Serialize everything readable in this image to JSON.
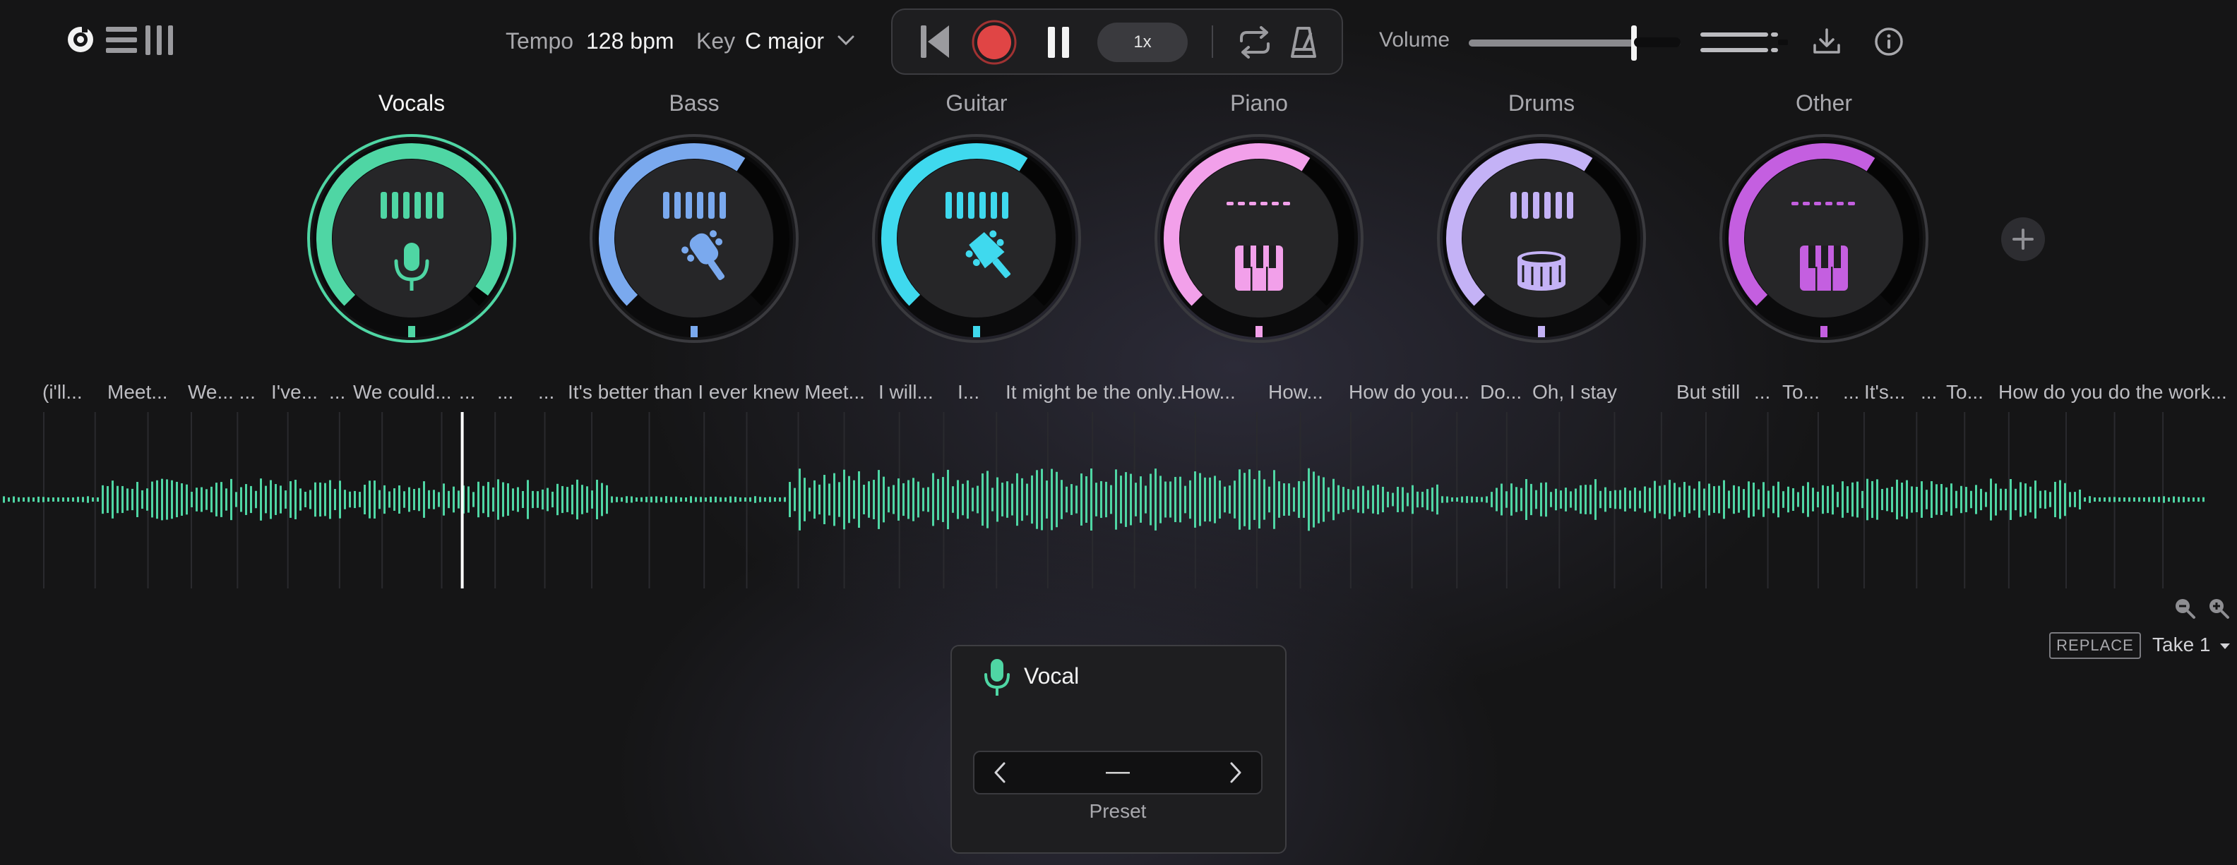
{
  "toolbar": {
    "logo_icon": "record-logo-icon",
    "list_icon": "list-view-icon",
    "columns_icon": "columns-view-icon"
  },
  "project": {
    "tempo_label": "Tempo",
    "tempo_value": "128 bpm",
    "key_label": "Key",
    "key_value": "C major"
  },
  "transport": {
    "speed": "1x",
    "colors": {
      "record": "#e04545"
    }
  },
  "volume": {
    "label": "Volume",
    "level": 0.78
  },
  "stems": [
    {
      "name": "Vocals",
      "color": "#4fd6a4",
      "icon": "microphone-icon",
      "level": 0.97,
      "meter": "bars",
      "active": true
    },
    {
      "name": "Bass",
      "color": "#7aa9ee",
      "icon": "bass-guitar-icon",
      "level": 0.62,
      "meter": "bars",
      "active": false
    },
    {
      "name": "Guitar",
      "color": "#3fd9ee",
      "icon": "guitar-headstock-icon",
      "level": 0.62,
      "meter": "bars",
      "active": false
    },
    {
      "name": "Piano",
      "color": "#f2a0ea",
      "icon": "piano-keys-icon",
      "level": 0.62,
      "meter": "dashes",
      "active": false
    },
    {
      "name": "Drums",
      "color": "#c4b2f6",
      "icon": "snare-drum-icon",
      "level": 0.62,
      "meter": "bars",
      "active": false
    },
    {
      "name": "Other",
      "color": "#c45fe0",
      "icon": "piano-keys-icon",
      "level": 0.62,
      "meter": "dashes",
      "active": false
    }
  ],
  "lyrics": [
    "(i'll...",
    "Meet...",
    "We... ...",
    "I've...",
    "...",
    "We could...",
    "...",
    "...",
    "...",
    "It's better than I ever knew Meet...",
    "I will...",
    "I...",
    "It might be the only...",
    "How...",
    "How...",
    "How do you...",
    "Do...",
    "Oh, I stay",
    "But still",
    "...",
    "To...",
    "...",
    "It's...",
    "...",
    "To...",
    "How do you do the work..."
  ],
  "waveform": {
    "color": "#4fd6a4",
    "playhead_fraction": 0.206
  },
  "take": {
    "replace_label": "REPLACE",
    "take_label": "Take 1"
  },
  "vocal_panel": {
    "title": "Vocal",
    "preset_value": "—",
    "preset_label": "Preset"
  }
}
